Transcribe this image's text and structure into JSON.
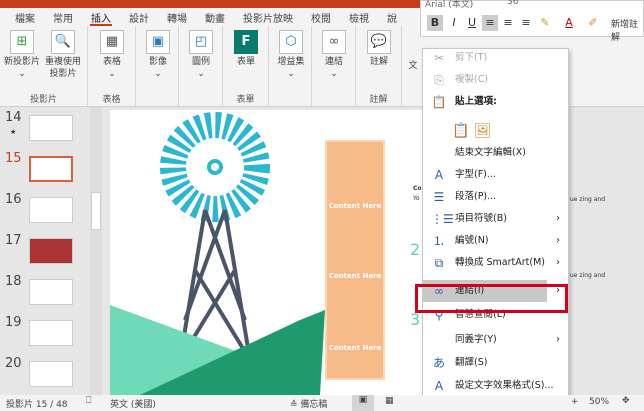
{
  "ribbon": {
    "tabs": [
      "檔案",
      "常用",
      "插入",
      "設計",
      "轉場",
      "動畫",
      "投影片放映",
      "校閱",
      "檢視",
      "說"
    ],
    "active_tab": "插入",
    "groups": [
      {
        "label": "投影片",
        "buttons": [
          "新投影片",
          "重複使用投影片"
        ]
      },
      {
        "label": "表格",
        "buttons": [
          "表格"
        ]
      },
      {
        "label": "",
        "buttons": [
          "影像"
        ]
      },
      {
        "label": "",
        "buttons": [
          "圖例"
        ]
      },
      {
        "label": "表單",
        "buttons": [
          "表單"
        ]
      },
      {
        "label": "",
        "buttons": [
          "增益集"
        ]
      },
      {
        "label": "",
        "buttons": [
          "連結"
        ]
      },
      {
        "label": "註解",
        "buttons": [
          "註解"
        ]
      }
    ],
    "text_partial": "文"
  },
  "mini_toolbar": {
    "font": "Arial (本文)",
    "size": "36",
    "new_comment": "新增註解",
    "buttons": [
      "B",
      "I",
      "U"
    ]
  },
  "slides": {
    "items": [
      {
        "num": "14",
        "star": "★"
      },
      {
        "num": "15"
      },
      {
        "num": "16"
      },
      {
        "num": "17"
      },
      {
        "num": "18"
      },
      {
        "num": "19"
      },
      {
        "num": "20"
      }
    ],
    "selected": "15"
  },
  "slide": {
    "content_labels": [
      "Content Here",
      "Content Here",
      "Content Here"
    ],
    "numbers": [
      "2",
      "3"
    ],
    "side_text": "ue zing and",
    "co": "Co",
    "yo": "Yo"
  },
  "context_menu": {
    "items": [
      {
        "label": "剪下(T)",
        "icon": "scissors-icon",
        "disabled": true
      },
      {
        "label": "複製(C)",
        "icon": "copy-icon",
        "disabled": true
      },
      {
        "label": "貼上選項:",
        "icon": "paste-icon"
      },
      {
        "label": "結束文字編輯(X)"
      },
      {
        "label": "字型(F)...",
        "icon": "font-icon"
      },
      {
        "label": "段落(P)...",
        "icon": "paragraph-icon"
      },
      {
        "label": "項目符號(B)",
        "icon": "bullets-icon",
        "submenu": true
      },
      {
        "label": "編號(N)",
        "icon": "numbering-icon",
        "submenu": true
      },
      {
        "label": "轉換成 SmartArt(M)",
        "icon": "smartart-icon",
        "submenu": true
      },
      {
        "label": "連結(I)",
        "icon": "link-icon",
        "submenu": true,
        "highlighted": true
      },
      {
        "label": "智慧查閱(L)",
        "icon": "search-icon"
      },
      {
        "label": "同義字(Y)",
        "submenu": true
      },
      {
        "label": "翻譯(S)",
        "icon": "translate-icon"
      },
      {
        "label": "設定文字效果格式(S)...",
        "icon": "text-effects-icon"
      }
    ]
  },
  "status": {
    "slide_count": "投影片 15 / 48",
    "language": "英文 (美國)",
    "notes": "備忘稿",
    "zoom": "50%"
  },
  "colors": {
    "accent": "#c43e1c",
    "highlight_box": "#d0021b",
    "orange": "#f7bb8a",
    "teal": "#2bb7d0",
    "green": "#1f9a6f"
  }
}
